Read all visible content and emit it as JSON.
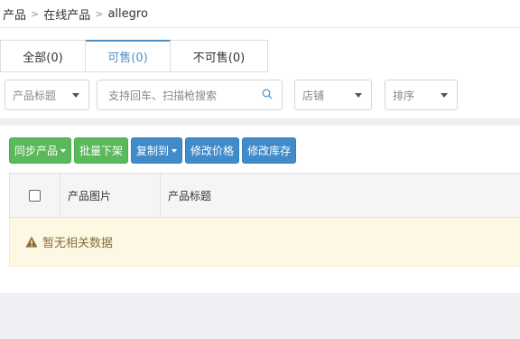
{
  "breadcrumb": {
    "items": [
      "产品",
      "在线产品",
      "allegro"
    ]
  },
  "tabs": [
    {
      "label": "全部(0)"
    },
    {
      "label": "可售(0)"
    },
    {
      "label": "不可售(0)"
    }
  ],
  "filters": {
    "field_select": "产品标题",
    "search_placeholder": "支持回车、扫描枪搜索",
    "shop_select": "店铺",
    "sort_select": "排序"
  },
  "toolbar": {
    "sync": "同步产品",
    "bulk_delist": "批量下架",
    "copy_to": "复制到",
    "edit_price": "修改价格",
    "edit_stock": "修改库存"
  },
  "table": {
    "columns": [
      "产品图片",
      "产品标题"
    ],
    "empty_text": "暂无相关数据"
  },
  "colors": {
    "accent": "#4a90c8",
    "green_button": "#5cb85c",
    "blue_button": "#428bca",
    "empty_bg": "#fcf8e3"
  }
}
